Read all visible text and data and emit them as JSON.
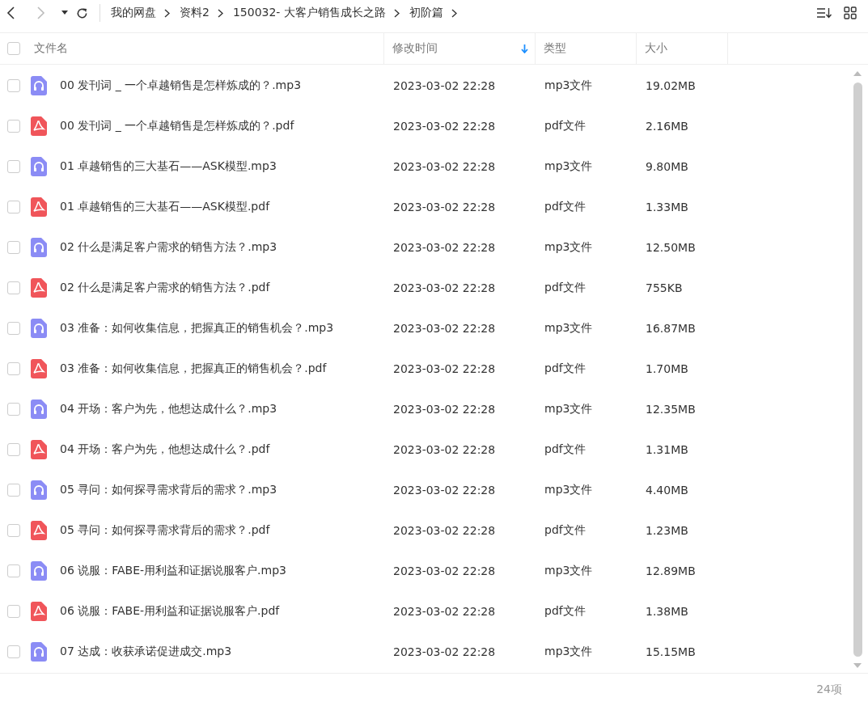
{
  "breadcrumb": [
    "我的网盘",
    "资料2",
    "150032- 大客户销售成长之路",
    "初阶篇"
  ],
  "table": {
    "select_all_checked": false,
    "columns": [
      {
        "label": "文件名",
        "sorted": false
      },
      {
        "label": "修改时间",
        "sorted": true
      },
      {
        "label": "类型",
        "sorted": false
      },
      {
        "label": "大小",
        "sorted": false
      }
    ],
    "rows": [
      {
        "kind": "mp3",
        "name": "00 发刊词 _ 一个卓越销售是怎样炼成的？.mp3",
        "modified": "2023-03-02 22:28",
        "type": "mp3文件",
        "size": "19.02MB",
        "checked": false
      },
      {
        "kind": "pdf",
        "name": "00 发刊词 _ 一个卓越销售是怎样炼成的？.pdf",
        "modified": "2023-03-02 22:28",
        "type": "pdf文件",
        "size": "2.16MB",
        "checked": false
      },
      {
        "kind": "mp3",
        "name": "01 卓越销售的三大基石——ASK模型.mp3",
        "modified": "2023-03-02 22:28",
        "type": "mp3文件",
        "size": "9.80MB",
        "checked": false
      },
      {
        "kind": "pdf",
        "name": "01 卓越销售的三大基石——ASK模型.pdf",
        "modified": "2023-03-02 22:28",
        "type": "pdf文件",
        "size": "1.33MB",
        "checked": false
      },
      {
        "kind": "mp3",
        "name": "02 什么是满足客户需求的销售方法？.mp3",
        "modified": "2023-03-02 22:28",
        "type": "mp3文件",
        "size": "12.50MB",
        "checked": false
      },
      {
        "kind": "pdf",
        "name": "02 什么是满足客户需求的销售方法？.pdf",
        "modified": "2023-03-02 22:28",
        "type": "pdf文件",
        "size": "755KB",
        "checked": false
      },
      {
        "kind": "mp3",
        "name": "03 准备：如何收集信息，把握真正的销售机会？.mp3",
        "modified": "2023-03-02 22:28",
        "type": "mp3文件",
        "size": "16.87MB",
        "checked": false
      },
      {
        "kind": "pdf",
        "name": "03 准备：如何收集信息，把握真正的销售机会？.pdf",
        "modified": "2023-03-02 22:28",
        "type": "pdf文件",
        "size": "1.70MB",
        "checked": false
      },
      {
        "kind": "mp3",
        "name": "04 开场：客户为先，他想达成什么？.mp3",
        "modified": "2023-03-02 22:28",
        "type": "mp3文件",
        "size": "12.35MB",
        "checked": false
      },
      {
        "kind": "pdf",
        "name": "04 开场：客户为先，他想达成什么？.pdf",
        "modified": "2023-03-02 22:28",
        "type": "pdf文件",
        "size": "1.31MB",
        "checked": false
      },
      {
        "kind": "mp3",
        "name": "05 寻问：如何探寻需求背后的需求？.mp3",
        "modified": "2023-03-02 22:28",
        "type": "mp3文件",
        "size": "4.40MB",
        "checked": false
      },
      {
        "kind": "pdf",
        "name": "05 寻问：如何探寻需求背后的需求？.pdf",
        "modified": "2023-03-02 22:28",
        "type": "pdf文件",
        "size": "1.23MB",
        "checked": false
      },
      {
        "kind": "mp3",
        "name": "06 说服：FABE-用利益和证据说服客户.mp3",
        "modified": "2023-03-02 22:28",
        "type": "mp3文件",
        "size": "12.89MB",
        "checked": false
      },
      {
        "kind": "pdf",
        "name": "06 说服：FABE-用利益和证据说服客户.pdf",
        "modified": "2023-03-02 22:28",
        "type": "pdf文件",
        "size": "1.38MB",
        "checked": false
      },
      {
        "kind": "mp3",
        "name": "07 达成：收获承诺促进成交.mp3",
        "modified": "2023-03-02 22:28",
        "type": "mp3文件",
        "size": "15.15MB",
        "checked": false
      }
    ]
  },
  "status_bar": {
    "count": "24项"
  }
}
